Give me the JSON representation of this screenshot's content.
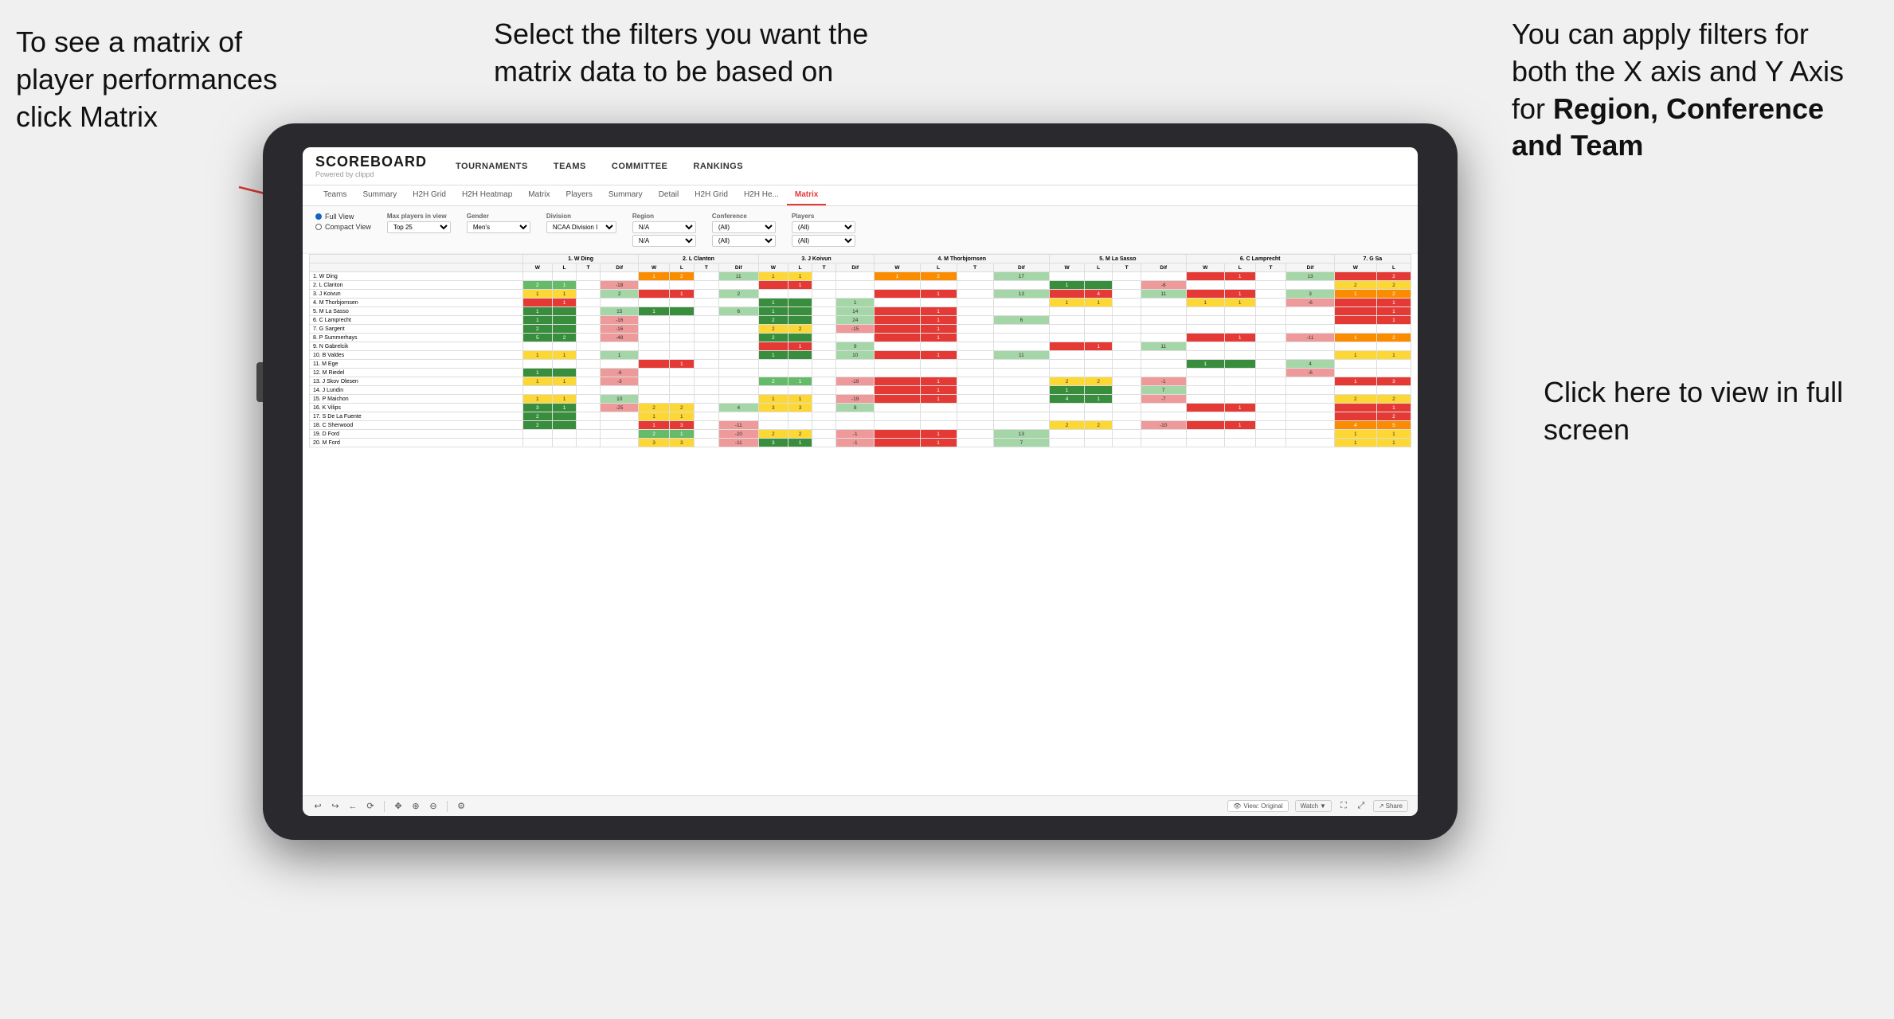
{
  "annotations": {
    "left": "To see a matrix of player performances click Matrix",
    "left_bold": "Matrix",
    "center": "Select the filters you want the matrix data to be based on",
    "right_top_1": "You  can apply filters for both the X axis and Y Axis for ",
    "right_top_bold": "Region, Conference and Team",
    "right_bottom": "Click here to view in full screen"
  },
  "nav": {
    "logo": "SCOREBOARD",
    "logo_sub": "Powered by clippd",
    "items": [
      "TOURNAMENTS",
      "TEAMS",
      "COMMITTEE",
      "RANKINGS"
    ]
  },
  "sub_nav": {
    "items": [
      "Teams",
      "Summary",
      "H2H Grid",
      "H2H Heatmap",
      "Matrix",
      "Players",
      "Summary",
      "Detail",
      "H2H Grid",
      "H2H He...",
      "Matrix"
    ],
    "active": "Matrix"
  },
  "filters": {
    "view_options": [
      "Full View",
      "Compact View"
    ],
    "max_players_label": "Max players in view",
    "max_players_value": "Top 25",
    "gender_label": "Gender",
    "gender_value": "Men's",
    "division_label": "Division",
    "division_value": "NCAA Division I",
    "region_label": "Region",
    "region_value": "N/A",
    "region_value2": "N/A",
    "conference_label": "Conference",
    "conference_value": "(All)",
    "conference_value2": "(All)",
    "players_label": "Players",
    "players_value": "(All)",
    "players_value2": "(All)"
  },
  "matrix": {
    "col_headers": [
      {
        "num": "1.",
        "name": "W Ding"
      },
      {
        "num": "2.",
        "name": "L Clanton"
      },
      {
        "num": "3.",
        "name": "J Koivun"
      },
      {
        "num": "4.",
        "name": "M Thorbjornsen"
      },
      {
        "num": "5.",
        "name": "M La Sasso"
      },
      {
        "num": "6.",
        "name": "C Lamprecht"
      },
      {
        "num": "7.",
        "name": "G Sa"
      }
    ],
    "sub_cols": [
      "W",
      "L",
      "T",
      "Dif"
    ],
    "rows": [
      {
        "num": "1.",
        "name": "W Ding",
        "cells": [
          [
            0,
            0,
            0,
            0
          ],
          [
            1,
            2,
            0,
            11
          ],
          [
            1,
            1,
            0,
            0
          ],
          [
            1,
            2,
            0,
            17
          ],
          [
            0,
            0,
            0,
            0
          ],
          [
            0,
            1,
            0,
            13
          ],
          [
            0,
            2
          ]
        ]
      },
      {
        "num": "2.",
        "name": "L Clanton",
        "cells": [
          [
            2,
            1,
            0,
            -18
          ],
          [
            0,
            0,
            0,
            0
          ],
          [
            0,
            1,
            0,
            0
          ],
          [
            0,
            0,
            0,
            0
          ],
          [
            1,
            0,
            0,
            -6
          ],
          [
            0,
            0,
            0,
            0
          ],
          [
            2,
            2
          ]
        ]
      },
      {
        "num": "3.",
        "name": "J Koivun",
        "cells": [
          [
            1,
            1,
            0,
            2
          ],
          [
            0,
            1,
            0,
            2
          ],
          [
            0,
            0,
            0,
            0
          ],
          [
            0,
            1,
            0,
            13
          ],
          [
            0,
            4,
            0,
            11
          ],
          [
            0,
            1,
            0,
            3
          ],
          [
            1,
            2
          ]
        ]
      },
      {
        "num": "4.",
        "name": "M Thorbjornsen",
        "cells": [
          [
            0,
            1,
            0,
            0
          ],
          [
            0,
            0,
            0,
            0
          ],
          [
            1,
            0,
            0,
            1
          ],
          [
            0,
            0,
            0,
            0
          ],
          [
            1,
            1,
            0,
            0
          ],
          [
            1,
            1,
            0,
            -6
          ],
          [
            0,
            1
          ]
        ]
      },
      {
        "num": "5.",
        "name": "M La Sasso",
        "cells": [
          [
            1,
            0,
            0,
            15
          ],
          [
            1,
            0,
            0,
            6
          ],
          [
            1,
            0,
            0,
            14
          ],
          [
            0,
            1,
            0,
            0
          ],
          [
            0,
            0,
            0,
            0
          ],
          [
            0,
            0,
            0,
            0
          ],
          [
            0,
            1
          ]
        ]
      },
      {
        "num": "6.",
        "name": "C Lamprecht",
        "cells": [
          [
            1,
            0,
            0,
            -16
          ],
          [
            0,
            0,
            0,
            0
          ],
          [
            2,
            0,
            0,
            24
          ],
          [
            0,
            1,
            0,
            6
          ],
          [
            0,
            0,
            0,
            0
          ],
          [
            0,
            0,
            0,
            0
          ],
          [
            0,
            1
          ]
        ]
      },
      {
        "num": "7.",
        "name": "G Sargent",
        "cells": [
          [
            2,
            0,
            0,
            -16
          ],
          [
            0,
            0,
            0,
            0
          ],
          [
            2,
            2,
            0,
            -15
          ],
          [
            0,
            1,
            0,
            0
          ],
          [
            0,
            0,
            0,
            0
          ],
          [
            0,
            0,
            0,
            0
          ],
          [
            0,
            0
          ]
        ]
      },
      {
        "num": "8.",
        "name": "P Summerhays",
        "cells": [
          [
            5,
            2,
            0,
            -48
          ],
          [
            0,
            0,
            0,
            0
          ],
          [
            2,
            0,
            0,
            0
          ],
          [
            0,
            1,
            0,
            0
          ],
          [
            0,
            0,
            0,
            0
          ],
          [
            0,
            1,
            0,
            -11
          ],
          [
            1,
            2
          ]
        ]
      },
      {
        "num": "9.",
        "name": "N Gabrelcik",
        "cells": [
          [
            0,
            0,
            0,
            0
          ],
          [
            0,
            0,
            0,
            0
          ],
          [
            0,
            1,
            0,
            9
          ],
          [
            0,
            0,
            0,
            0
          ],
          [
            0,
            1,
            0,
            11
          ],
          [
            0,
            0,
            0,
            0
          ],
          [
            0,
            0
          ]
        ]
      },
      {
        "num": "10.",
        "name": "B Valdes",
        "cells": [
          [
            1,
            1,
            0,
            1
          ],
          [
            0,
            0,
            0,
            0
          ],
          [
            1,
            0,
            0,
            10
          ],
          [
            0,
            1,
            0,
            11
          ],
          [
            0,
            0,
            0,
            0
          ],
          [
            0,
            0,
            0,
            0
          ],
          [
            1,
            1
          ]
        ]
      },
      {
        "num": "11.",
        "name": "M Ege",
        "cells": [
          [
            0,
            0,
            0,
            0
          ],
          [
            0,
            1,
            0,
            0
          ],
          [
            0,
            0,
            0,
            0
          ],
          [
            0,
            0,
            0,
            0
          ],
          [
            0,
            0,
            0,
            0
          ],
          [
            1,
            0,
            0,
            4
          ],
          [
            0,
            0
          ]
        ]
      },
      {
        "num": "12.",
        "name": "M Riedel",
        "cells": [
          [
            1,
            0,
            0,
            -6
          ],
          [
            0,
            0,
            0,
            0
          ],
          [
            0,
            0,
            0,
            0
          ],
          [
            0,
            0,
            0,
            0
          ],
          [
            0,
            0,
            0,
            0
          ],
          [
            0,
            0,
            0,
            -6
          ],
          [
            0,
            0
          ]
        ]
      },
      {
        "num": "13.",
        "name": "J Skov Olesen",
        "cells": [
          [
            1,
            1,
            0,
            -3
          ],
          [
            0,
            0,
            0,
            0
          ],
          [
            2,
            1,
            0,
            -19
          ],
          [
            0,
            1,
            0,
            0
          ],
          [
            2,
            2,
            0,
            -1
          ],
          [
            0,
            0,
            0,
            0
          ],
          [
            1,
            3
          ]
        ]
      },
      {
        "num": "14.",
        "name": "J Lundin",
        "cells": [
          [
            0,
            0,
            0,
            0
          ],
          [
            0,
            0,
            0,
            0
          ],
          [
            0,
            0,
            0,
            0
          ],
          [
            0,
            1,
            0,
            0
          ],
          [
            1,
            0,
            0,
            7
          ],
          [
            0,
            0,
            0,
            0
          ],
          [
            0,
            0
          ]
        ]
      },
      {
        "num": "15.",
        "name": "P Maichon",
        "cells": [
          [
            1,
            1,
            0,
            10
          ],
          [
            0,
            0,
            0,
            0
          ],
          [
            1,
            1,
            0,
            -19
          ],
          [
            0,
            1,
            0,
            0
          ],
          [
            4,
            1,
            0,
            -7
          ],
          [
            0,
            0,
            0,
            0
          ],
          [
            2,
            2
          ]
        ]
      },
      {
        "num": "16.",
        "name": "K Vilips",
        "cells": [
          [
            3,
            1,
            0,
            -25
          ],
          [
            2,
            2,
            0,
            4
          ],
          [
            3,
            3,
            0,
            8
          ],
          [
            0,
            0,
            0,
            0
          ],
          [
            0,
            0,
            0,
            0
          ],
          [
            0,
            1,
            0,
            0
          ],
          [
            0,
            1
          ]
        ]
      },
      {
        "num": "17.",
        "name": "S De La Fuente",
        "cells": [
          [
            2,
            0,
            0,
            0
          ],
          [
            1,
            1,
            0,
            0
          ],
          [
            0,
            0,
            0,
            0
          ],
          [
            0,
            0,
            0,
            0
          ],
          [
            0,
            0,
            0,
            0
          ],
          [
            0,
            0,
            0,
            0
          ],
          [
            0,
            2
          ]
        ]
      },
      {
        "num": "18.",
        "name": "C Sherwood",
        "cells": [
          [
            2,
            0,
            0,
            0
          ],
          [
            1,
            3,
            0,
            -11
          ],
          [
            0,
            0,
            0,
            0
          ],
          [
            0,
            0,
            0,
            0
          ],
          [
            2,
            2,
            0,
            -10
          ],
          [
            0,
            1,
            0,
            0
          ],
          [
            4,
            5
          ]
        ]
      },
      {
        "num": "19.",
        "name": "D Ford",
        "cells": [
          [
            0,
            0,
            0,
            0
          ],
          [
            2,
            1,
            0,
            -20
          ],
          [
            2,
            2,
            0,
            -1
          ],
          [
            0,
            1,
            0,
            13
          ],
          [
            0,
            0,
            0,
            0
          ],
          [
            0,
            0,
            0,
            0
          ],
          [
            1,
            1
          ]
        ]
      },
      {
        "num": "20.",
        "name": "M Ford",
        "cells": [
          [
            0,
            0,
            0,
            0
          ],
          [
            3,
            3,
            0,
            -11
          ],
          [
            3,
            1,
            0,
            -1
          ],
          [
            0,
            1,
            0,
            7
          ],
          [
            0,
            0,
            0,
            0
          ],
          [
            0,
            0,
            0,
            0
          ],
          [
            1,
            1
          ]
        ]
      }
    ]
  },
  "toolbar": {
    "view_original": "View: Original",
    "watch": "Watch",
    "share": "Share"
  }
}
